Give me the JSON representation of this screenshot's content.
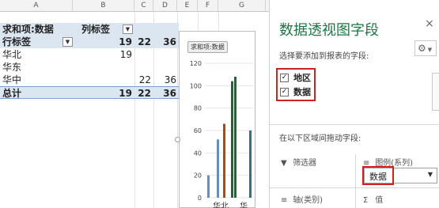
{
  "sheet": {
    "columns": [
      "A",
      "B",
      "C",
      "D",
      "E",
      "F",
      "G"
    ],
    "header_row": {
      "a": "求和项:数据",
      "b": "列标签"
    },
    "rows": [
      {
        "label": "行标签",
        "b": "19",
        "c": "22",
        "d": "36"
      },
      {
        "label": "华北",
        "b": "19",
        "c": "",
        "d": ""
      },
      {
        "label": "华东",
        "b": "",
        "c": "",
        "d": ""
      },
      {
        "label": "华中",
        "b": "",
        "c": "22",
        "d": "36"
      },
      {
        "label": "总计",
        "b": "19",
        "c": "22",
        "d": "36"
      }
    ]
  },
  "chart": {
    "badge": "求和项:数据",
    "x_labels": [
      "华北",
      "华"
    ]
  },
  "chart_data": {
    "type": "bar",
    "yticks": [
      "120",
      "100",
      "80",
      "60",
      "40",
      "20",
      "0"
    ],
    "ylim": [
      0,
      120
    ],
    "x_labels": [
      "华北",
      "华"
    ],
    "bars": [
      {
        "value": 20,
        "color": "#6a8fb5"
      },
      {
        "value": 52,
        "color": "#6a8fb5"
      },
      {
        "value": 66,
        "color": "#8a5530"
      },
      {
        "value": 104,
        "color": "#2f5d3f"
      },
      {
        "value": 108,
        "color": "#2f5d3f"
      },
      {
        "value": 60,
        "color": "#3a6b8a"
      }
    ]
  },
  "pane": {
    "title": "数据透视图字段",
    "pick_label": "选择要添加到报表的字段:",
    "fields": [
      "地区",
      "数据"
    ],
    "drag_label": "在以下区域间拖动字段:",
    "filter_label": "筛选器",
    "legend_label": "图例(系列)",
    "legend_value": "数据",
    "axis_label": "轴(类别)",
    "values_label": "值"
  },
  "icons": {
    "filter": "filter-icon",
    "legend": "legend-icon",
    "axis": "axis-icon",
    "values": "sigma-icon",
    "settings": "gear-icon",
    "close": "close-icon"
  },
  "colors": {
    "accent": "#217346",
    "highlight": "#dce6f1",
    "callout": "#d21f1f"
  }
}
